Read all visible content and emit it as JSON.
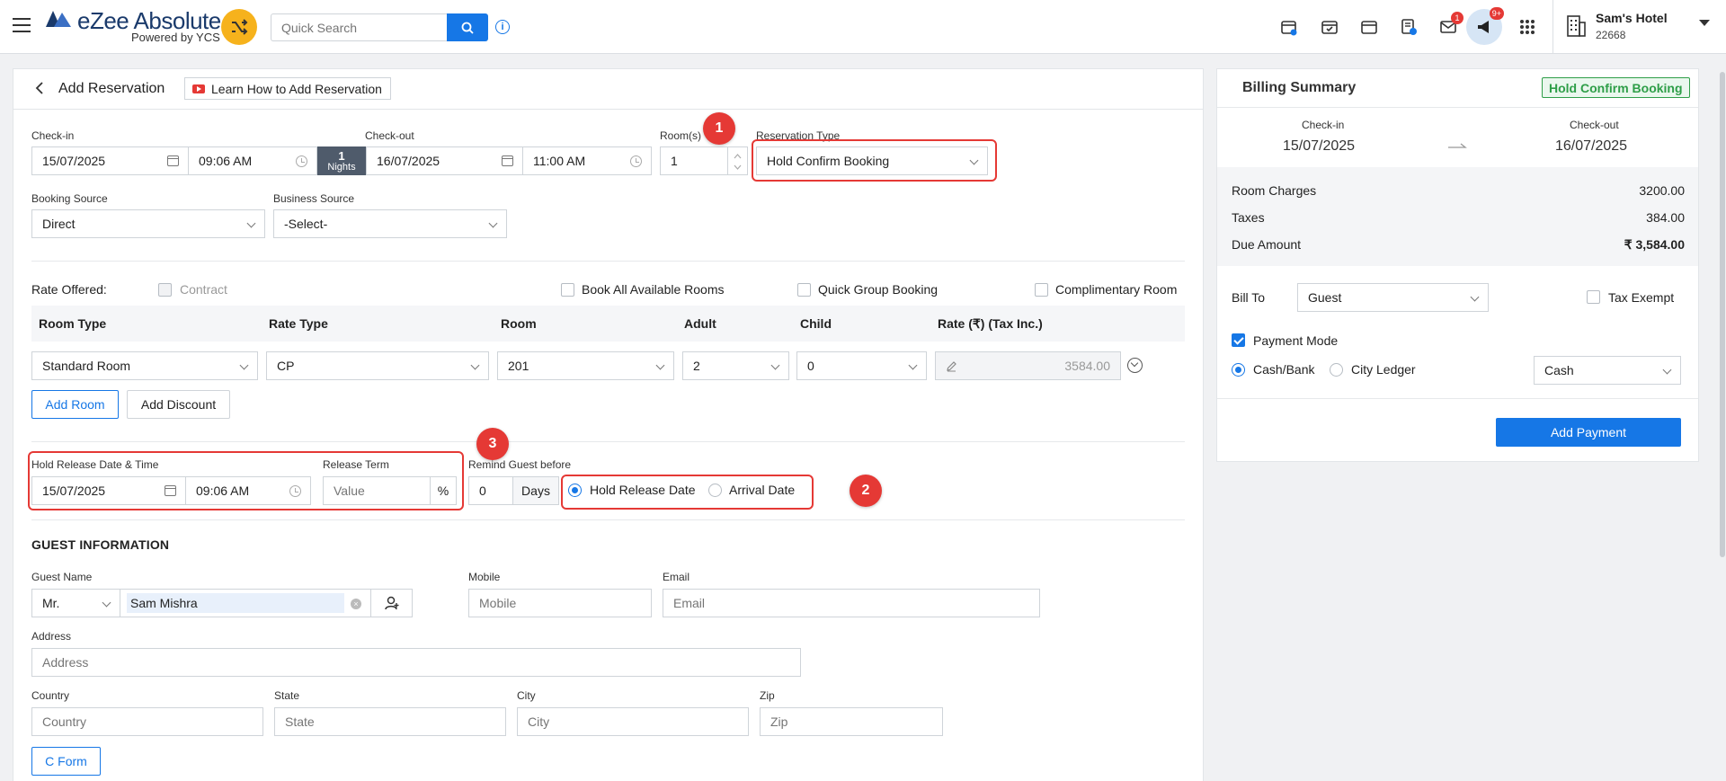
{
  "header": {
    "logo_text": "eZee Absolute",
    "logo_sub": "Powered by YCS",
    "search_placeholder": "Quick Search",
    "mail_badge": "1",
    "announce_badge": "9+",
    "hotel_name": "Sam's Hotel",
    "hotel_id": "22668"
  },
  "page": {
    "title": "Add Reservation",
    "learn_label": "Learn How to Add Reservation"
  },
  "stay": {
    "checkin_label": "Check-in",
    "checkin_date": "15/07/2025",
    "checkin_time": "09:06 AM",
    "nights_count": "1",
    "nights_label": "Nights",
    "checkout_label": "Check-out",
    "checkout_date": "16/07/2025",
    "checkout_time": "11:00 AM",
    "rooms_label": "Room(s)",
    "rooms_value": "1",
    "res_type_label": "Reservation Type",
    "res_type_value": "Hold Confirm Booking",
    "booking_source_label": "Booking Source",
    "booking_source_value": "Direct",
    "business_source_label": "Business Source",
    "business_source_value": "-Select-"
  },
  "rates": {
    "rate_offered_label": "Rate Offered:",
    "contract_label": "Contract",
    "book_all_label": "Book All Available Rooms",
    "quick_group_label": "Quick Group Booking",
    "complimentary_label": "Complimentary Room",
    "columns": [
      "Room Type",
      "Rate Type",
      "Room",
      "Adult",
      "Child",
      "Rate (₹)  (Tax Inc.)"
    ],
    "row": {
      "room_type": "Standard Room",
      "rate_type": "CP",
      "room": "201",
      "adult": "2",
      "child": "0",
      "rate": "3584.00"
    },
    "add_room_label": "Add Room",
    "add_discount_label": "Add Discount"
  },
  "hold": {
    "release_label": "Hold Release Date & Time",
    "release_date": "15/07/2025",
    "release_time": "09:06 AM",
    "term_label": "Release Term",
    "term_placeholder": "Value",
    "term_unit": "%",
    "remind_label": "Remind Guest before",
    "remind_value": "0",
    "remind_unit": "Days",
    "opt_hold_release": "Hold Release Date",
    "opt_arrival": "Arrival Date"
  },
  "annotations": [
    "1",
    "2",
    "3"
  ],
  "guest": {
    "section_title": "GUEST INFORMATION",
    "name_label": "Guest Name",
    "salutation": "Mr.",
    "name_value": "Sam Mishra",
    "mobile_label": "Mobile",
    "mobile_placeholder": "Mobile",
    "email_label": "Email",
    "email_placeholder": "Email",
    "address_label": "Address",
    "address_placeholder": "Address",
    "country_label": "Country",
    "country_placeholder": "Country",
    "state_label": "State",
    "state_placeholder": "State",
    "city_label": "City",
    "city_placeholder": "City",
    "zip_label": "Zip",
    "zip_placeholder": "Zip",
    "cform_label": "C Form"
  },
  "billing": {
    "title": "Billing Summary",
    "status": "Hold Confirm Booking",
    "checkin_label": "Check-in",
    "checkin_date": "15/07/2025",
    "checkout_label": "Check-out",
    "checkout_date": "16/07/2025",
    "room_charges_label": "Room Charges",
    "room_charges_value": "3200.00",
    "taxes_label": "Taxes",
    "taxes_value": "384.00",
    "due_label": "Due Amount",
    "due_value": "₹ 3,584.00",
    "bill_to_label": "Bill To",
    "bill_to_value": "Guest",
    "tax_exempt_label": "Tax Exempt",
    "payment_mode_label": "Payment Mode",
    "cash_bank_label": "Cash/Bank",
    "city_ledger_label": "City Ledger",
    "payment_type_value": "Cash",
    "add_payment_label": "Add Payment"
  },
  "colors": {
    "primary": "#1677e6",
    "annotation_red": "#e53935",
    "status_green": "#2e9e48",
    "nights_bg": "#4f5b6b"
  }
}
